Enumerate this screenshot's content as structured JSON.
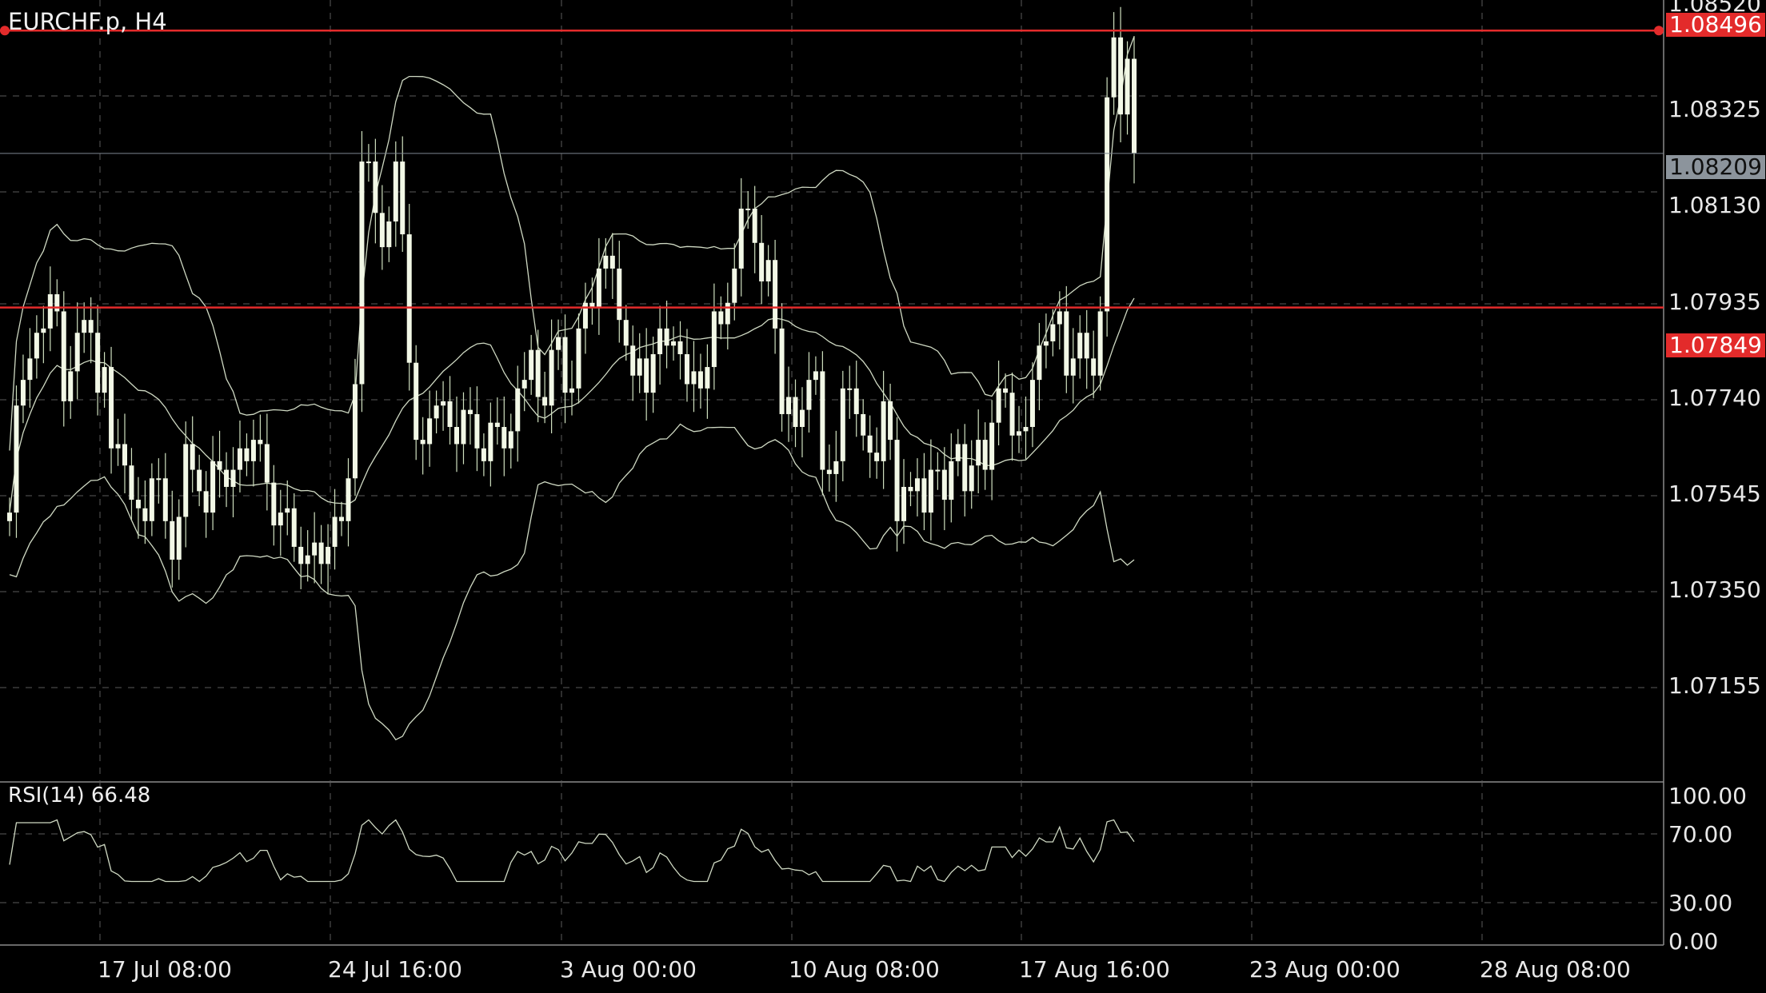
{
  "header": {
    "symbol_timeframe": "EURCHF.p, H4"
  },
  "colors": {
    "background": "#000000",
    "grid": "#5a5a5a",
    "candles": "#f2f8e6",
    "wicks": "#cfe0bf",
    "bands": "#cfd9c3",
    "hline": "#e32b2b",
    "current_tag": "#8c949c"
  },
  "price_axis": {
    "top_partial": "1.08520",
    "labels": [
      "1.08325",
      "1.08130",
      "1.07935",
      "1.07740",
      "1.07545",
      "1.07350",
      "1.07155"
    ],
    "current_price": "1.08209",
    "hlines": [
      "1.08496",
      "1.07849"
    ]
  },
  "rsi": {
    "label": "RSI(14) 66.48",
    "levels": [
      "100.00",
      "70.00",
      "30.00",
      "0.00"
    ]
  },
  "time_axis": {
    "labels": [
      "17 Jul 08:00",
      "24 Jul 16:00",
      "3 Aug 00:00",
      "10 Aug 08:00",
      "17 Aug 16:00",
      "23 Aug 00:00",
      "28 Aug 08:00"
    ]
  },
  "chart_data": {
    "type": "candlestick",
    "symbol": "EURCHF.p",
    "timeframe": "H4",
    "ylim": [
      1.0695,
      1.0853
    ],
    "horizontal_lines": [
      1.08496,
      1.07849
    ],
    "current_price": 1.08209,
    "indicators": [
      "Bollinger Bands",
      "RSI(14)"
    ],
    "rsi_value": 66.48,
    "rsi_levels": [
      70,
      30
    ],
    "close_approx": [
      1.0737,
      1.0762,
      1.0768,
      1.0773,
      1.0779,
      1.078,
      1.0788,
      1.0784,
      1.0763,
      1.077,
      1.0779,
      1.0782,
      1.0779,
      1.0765,
      1.0771,
      1.0752,
      1.0753,
      1.0748,
      1.074,
      1.0738,
      1.0735,
      1.0745,
      1.0745,
      1.0735,
      1.0726,
      1.0736,
      1.0753,
      1.0747,
      1.0742,
      1.0737,
      1.0749,
      1.0747,
      1.0743,
      1.0747,
      1.0752,
      1.0749,
      1.0754,
      1.0753,
      1.0744,
      1.0734,
      1.0737,
      1.0738,
      1.0729,
      1.0725,
      1.0727,
      1.073,
      1.0725,
      1.0729,
      1.0736,
      1.0735,
      1.0745,
      1.0767,
      1.0819,
      1.0819,
      1.0807,
      1.0799,
      1.0805,
      1.0819,
      1.0802,
      1.0772,
      1.0754,
      1.0753,
      1.0759,
      1.0762,
      1.0763,
      1.0757,
      1.0753,
      1.0761,
      1.076,
      1.0752,
      1.0749,
      1.0758,
      1.0757,
      1.0752,
      1.0756,
      1.0766,
      1.0768,
      1.0775,
      1.0764,
      1.0762,
      1.0775,
      1.0778,
      1.0765,
      1.0766,
      1.078,
      1.0786,
      1.0785,
      1.0794,
      1.0797,
      1.0794,
      1.0782,
      1.0776,
      1.0769,
      1.0773,
      1.0765,
      1.0774,
      1.078,
      1.0776,
      1.0777,
      1.0774,
      1.0767,
      1.077,
      1.0766,
      1.0771,
      1.0784,
      1.0781,
      1.0786,
      1.0794,
      1.0808,
      1.0808,
      1.08,
      1.0791,
      1.0796,
      1.078,
      1.076,
      1.0764,
      1.0757,
      1.0761,
      1.0768,
      1.077,
      1.0747,
      1.0746,
      1.0749,
      1.0766,
      1.0766,
      1.076,
      1.0755,
      1.0751,
      1.0749,
      1.0763,
      1.0754,
      1.0735,
      1.0743,
      1.0742,
      1.0745,
      1.0737,
      1.0747,
      1.0747,
      1.074,
      1.0749,
      1.0753,
      1.0742,
      1.0748,
      1.0754,
      1.0747,
      1.0758,
      1.0766,
      1.0765,
      1.0755,
      1.0756,
      1.0757,
      1.0768,
      1.0776,
      1.0777,
      1.0781,
      1.0784,
      1.0769,
      1.0773,
      1.0779,
      1.0773,
      1.0769,
      1.0784,
      1.0834,
      1.0848,
      1.083,
      1.0843,
      1.0821
    ]
  }
}
